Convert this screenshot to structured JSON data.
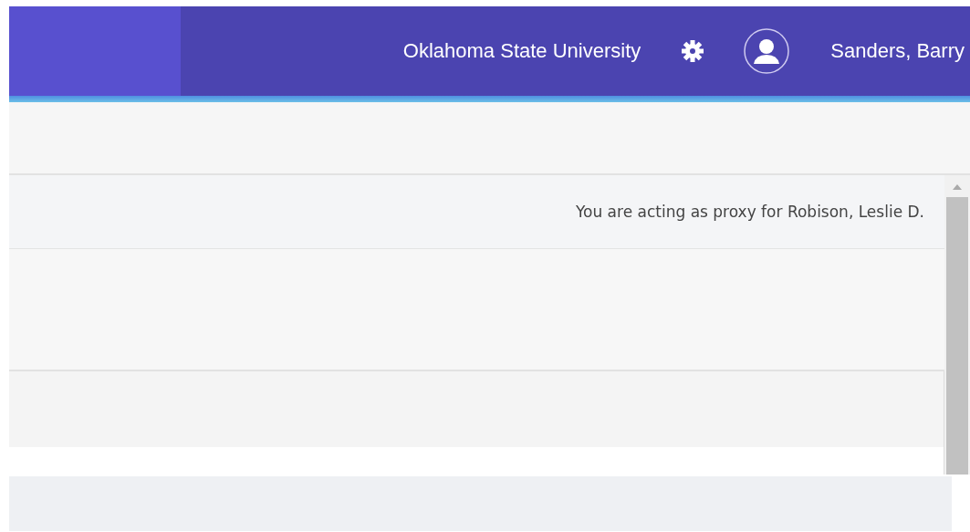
{
  "header": {
    "institution": "Oklahoma State University",
    "user_name": "Sanders, Barry"
  },
  "proxy_notice": "You are acting as proxy for Robison, Leslie D."
}
